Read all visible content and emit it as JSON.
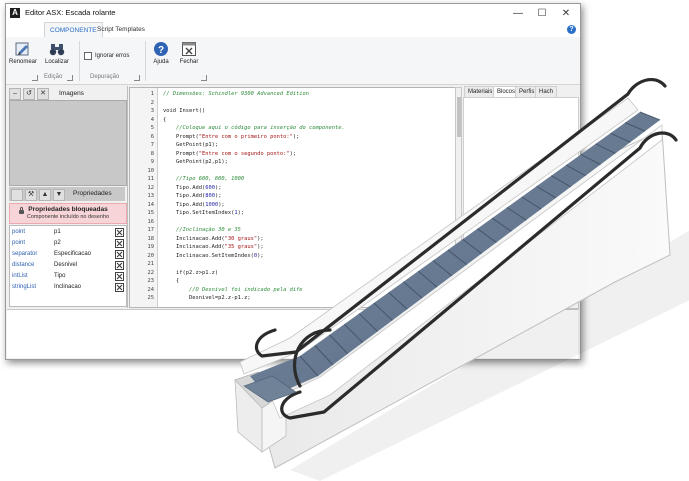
{
  "window": {
    "title": "Editor ASX: Escada rolante",
    "minimize": "—",
    "maximize": "☐",
    "close": "✕"
  },
  "ribbon": {
    "tabs": [
      "COMPONENTE",
      "Script Templates"
    ],
    "active_tab": "COMPONENTE",
    "buttons": {
      "renomear": "Renomear",
      "localizar": "Localizar",
      "ignorar_erros": "Ignorar erros",
      "ajuda": "Ajuda",
      "fechar": "Fechar"
    },
    "groups": [
      "Edição",
      "Depuração"
    ]
  },
  "left_panel": {
    "images_label": "Imagens",
    "properties_label": "Propriedades",
    "locked_title": "Propriedades bloqueadas",
    "locked_subtitle": "Componente incluído no desenho",
    "properties": [
      {
        "type": "point",
        "name": "p1"
      },
      {
        "type": "point",
        "name": "p2"
      },
      {
        "type": "separator",
        "name": "Especificacao"
      },
      {
        "type": "distance",
        "name": "Desnivel"
      },
      {
        "type": "intList",
        "name": "Tipo"
      },
      {
        "type": "stringList",
        "name": "Inclinacao"
      }
    ]
  },
  "editor": {
    "lines": [
      {
        "n": "1",
        "text": "// Dimensões: Schindler 9300 Advanced Edition",
        "kind": "comment"
      },
      {
        "n": "2",
        "text": "",
        "kind": "code"
      },
      {
        "n": "3",
        "text": "void Insert()",
        "kind": "code"
      },
      {
        "n": "4",
        "text": "{",
        "kind": "code"
      },
      {
        "n": "5",
        "text": "    //Coloque aqui o código para inserção do componente.",
        "kind": "comment"
      },
      {
        "n": "6",
        "text": "    Prompt(\"Entre com o primeiro ponto:\");",
        "kind": "code"
      },
      {
        "n": "7",
        "text": "    GetPoint(p1);",
        "kind": "code"
      },
      {
        "n": "8",
        "text": "    Prompt(\"Entre com o segundo ponto:\");",
        "kind": "code"
      },
      {
        "n": "9",
        "text": "    GetPoint(p2,p1);",
        "kind": "code"
      },
      {
        "n": "10",
        "text": "",
        "kind": "code"
      },
      {
        "n": "11",
        "text": "    //Tipo 600, 800, 1000",
        "kind": "comment"
      },
      {
        "n": "12",
        "text": "    Tipo.Add(600);",
        "kind": "code"
      },
      {
        "n": "13",
        "text": "    Tipo.Add(800);",
        "kind": "code"
      },
      {
        "n": "14",
        "text": "    Tipo.Add(1000);",
        "kind": "code"
      },
      {
        "n": "15",
        "text": "    Tipo.SetItemIndex(1);",
        "kind": "code"
      },
      {
        "n": "16",
        "text": "",
        "kind": "code"
      },
      {
        "n": "17",
        "text": "    //Inclinação 30 e 35",
        "kind": "comment"
      },
      {
        "n": "18",
        "text": "    Inclinacao.Add(\"30 graus\");",
        "kind": "code"
      },
      {
        "n": "19",
        "text": "    Inclinacao.Add(\"35 graus\");",
        "kind": "code"
      },
      {
        "n": "20",
        "text": "    Inclinacao.SetItemIndex(0);",
        "kind": "code"
      },
      {
        "n": "21",
        "text": "",
        "kind": "code"
      },
      {
        "n": "22",
        "text": "    if(p2.z>p1.z)",
        "kind": "code"
      },
      {
        "n": "23",
        "text": "    {",
        "kind": "code"
      },
      {
        "n": "24",
        "text": "        //O Desnivel foi indicado pela dife",
        "kind": "comment"
      },
      {
        "n": "25",
        "text": "        Desnivel=p2.z-p1.z;",
        "kind": "code"
      }
    ]
  },
  "right_panel": {
    "tabs": [
      "Materiais",
      "Blocos",
      "Perfis",
      "Hach"
    ],
    "active_tab": "Blocos"
  },
  "colors": {
    "accent": "#2a6fc7",
    "comment": "#2e8b3a",
    "string": "#a31515",
    "number": "#1a1aa6",
    "locked_bg": "#f7d4d7",
    "escalator_steps": "#6b7f96",
    "escalator_side": "#f2f2f2",
    "handrail": "#2a2a2a"
  },
  "icons": {
    "renomear": "rename-icon",
    "localizar": "binoculars-icon",
    "ajuda": "help-icon",
    "fechar": "close-window-icon",
    "lock": "lock-icon"
  }
}
